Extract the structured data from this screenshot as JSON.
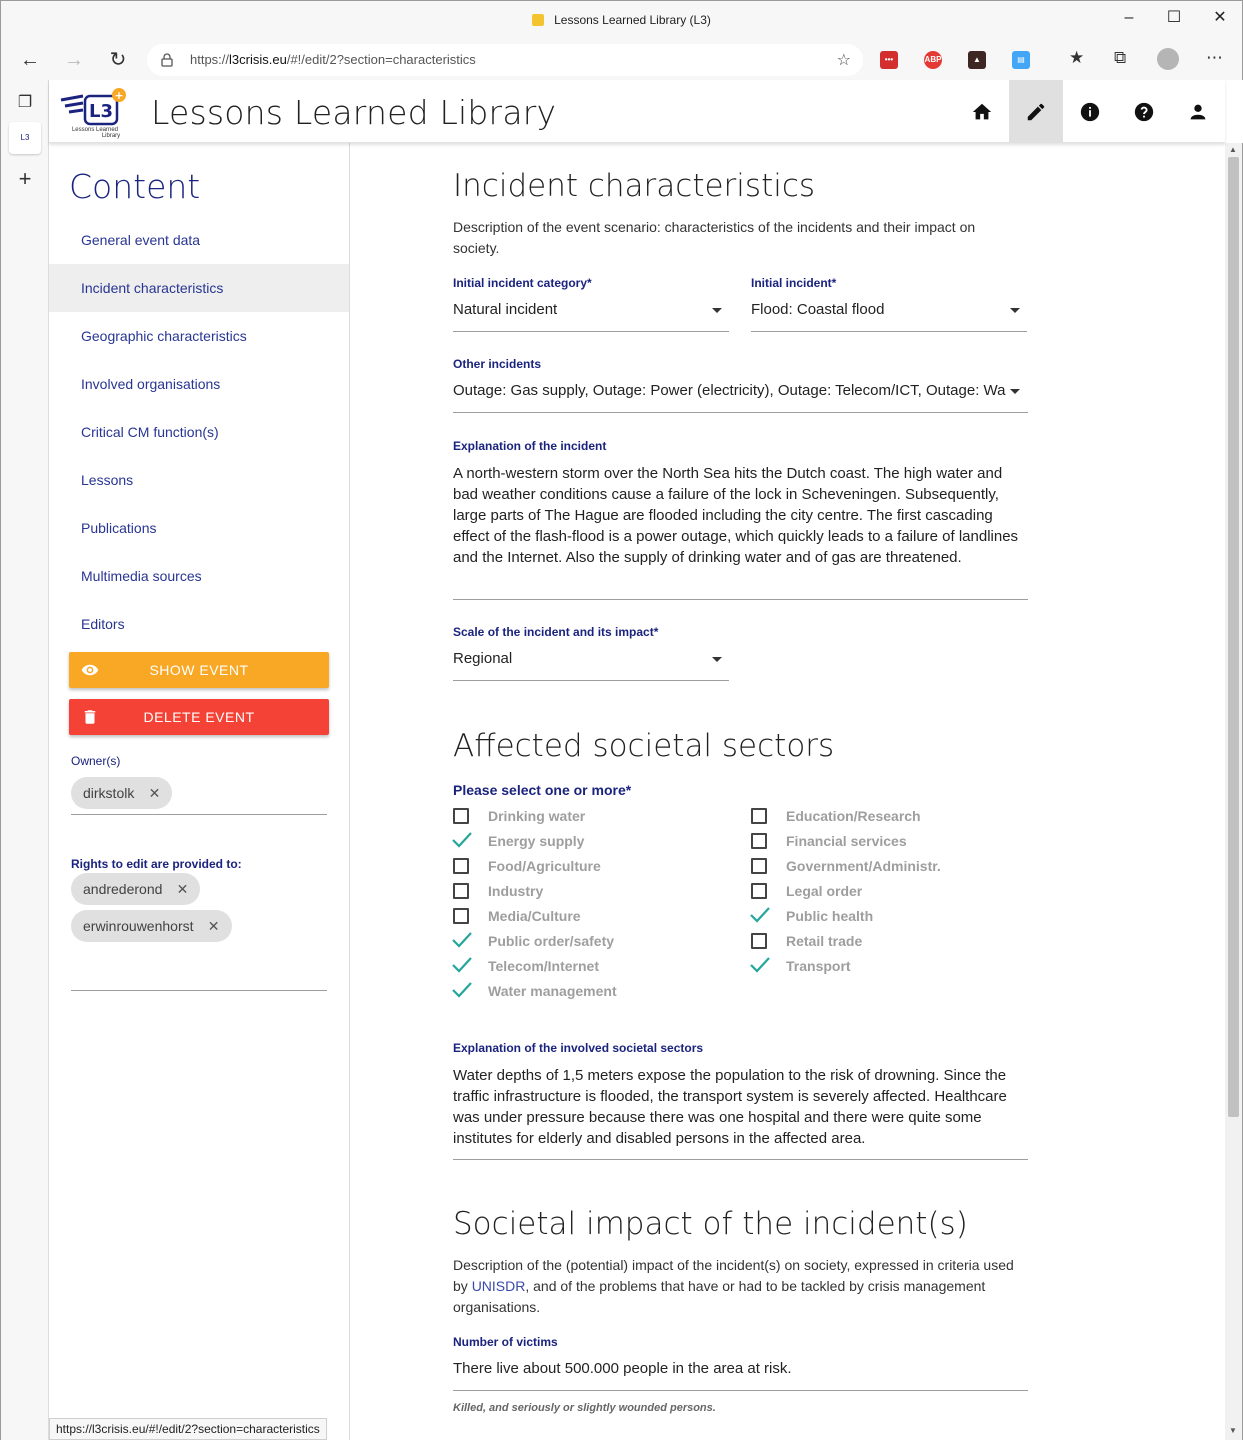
{
  "browser": {
    "window_title": "Lessons Learned Library (L3)",
    "url_prefix": "https://",
    "url_domain": "l3crisis.eu",
    "url_path": "/#!/edit/2?section=characteristics",
    "status_url": "https://l3crisis.eu/#!/edit/2?section=characteristics"
  },
  "app": {
    "title": "Lessons Learned Library",
    "logo_text": "L3",
    "logo_caption": "Lessons Learned Library"
  },
  "header_buttons": [
    {
      "icon": "home-icon"
    },
    {
      "icon": "edit-icon"
    },
    {
      "icon": "info-icon"
    },
    {
      "icon": "help-icon"
    },
    {
      "icon": "account-icon"
    }
  ],
  "sidebar": {
    "title": "Content",
    "items": [
      {
        "label": "General event data"
      },
      {
        "label": "Incident characteristics"
      },
      {
        "label": "Geographic characteristics"
      },
      {
        "label": "Involved organisations"
      },
      {
        "label": "Critical CM function(s)"
      },
      {
        "label": "Lessons"
      },
      {
        "label": "Publications"
      },
      {
        "label": "Multimedia sources"
      },
      {
        "label": "Editors"
      }
    ],
    "show_event": "SHOW EVENT",
    "delete_event": "DELETE EVENT",
    "owners_label": "Owner(s)",
    "owners": [
      "dirkstolk"
    ],
    "rights_label": "Rights to edit are provided to:",
    "editors": [
      "andrederond",
      "erwinrouwenhorst"
    ]
  },
  "incident": {
    "title": "Incident characteristics",
    "description": "Description of the event scenario: characteristics of the incidents and their impact on society.",
    "category_label": "Initial incident category*",
    "category_value": "Natural incident",
    "initial_label": "Initial incident*",
    "initial_value": "Flood: Coastal flood",
    "other_label": "Other incidents",
    "other_value": "Outage: Gas supply, Outage: Power (electricity), Outage: Telecom/ICT, Outage: Wa",
    "explanation_label": "Explanation of the incident",
    "explanation_value": "A north-western storm over the North Sea hits the Dutch coast. The high water and bad weather conditions cause a failure of the lock in Scheveningen. Subsequently, large parts of The Hague are flooded including the city centre. The first cascading effect of the flash-flood is a power outage, which quickly leads to a failure of landlines and the Internet. Also the supply of drinking water and of gas are threatened.",
    "scale_label": "Scale of the incident and its impact*",
    "scale_value": "Regional"
  },
  "sectors": {
    "title": "Affected societal sectors",
    "prompt": "Please select one or more*",
    "left": [
      {
        "label": "Drinking water",
        "checked": false
      },
      {
        "label": "Energy supply",
        "checked": true
      },
      {
        "label": "Food/Agriculture",
        "checked": false
      },
      {
        "label": "Industry",
        "checked": false
      },
      {
        "label": "Media/Culture",
        "checked": false
      },
      {
        "label": "Public order/safety",
        "checked": true
      },
      {
        "label": "Telecom/Internet",
        "checked": true
      },
      {
        "label": "Water management",
        "checked": true
      }
    ],
    "right": [
      {
        "label": "Education/Research",
        "checked": false
      },
      {
        "label": "Financial services",
        "checked": false
      },
      {
        "label": "Government/Administr.",
        "checked": false
      },
      {
        "label": "Legal order",
        "checked": false
      },
      {
        "label": "Public health",
        "checked": true
      },
      {
        "label": "Retail trade",
        "checked": false
      },
      {
        "label": "Transport",
        "checked": true
      }
    ],
    "explanation_label": "Explanation of the involved societal sectors",
    "explanation_value": "Water depths of 1,5 meters expose the population to the risk of drowning. Since the traffic infrastructure is flooded, the transport system is severely affected. Healthcare was under pressure because there was one hospital and there were quite some institutes for elderly and disabled persons in the affected area."
  },
  "impact": {
    "title": "Societal impact of the incident(s)",
    "desc_part1": "Description of the (potential) impact of the incident(s) on society, expressed in criteria used by ",
    "desc_link": "UNISDR",
    "desc_part2": ", and of the problems that have or had to be tackled by crisis management organisations.",
    "victims_label": "Number of victims",
    "victims_value": "There live about 500.000 people in the area at risk.",
    "victims_hint": "Killed, and seriously or slightly wounded persons."
  },
  "colors": {
    "accent": "#1a237e",
    "show_button": "#f9a825",
    "delete_button": "#f44336",
    "check": "#26a69a"
  }
}
